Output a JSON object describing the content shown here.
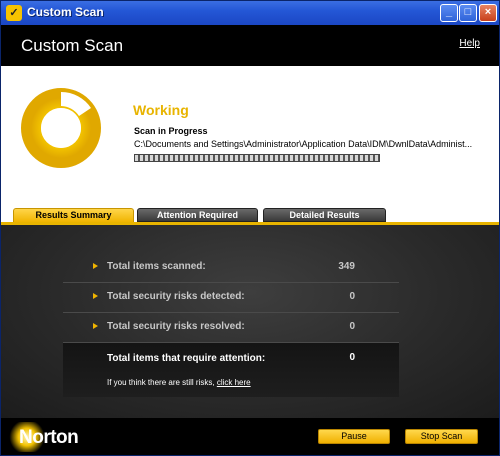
{
  "window": {
    "title": "Custom Scan",
    "controls": {
      "minimize": "_",
      "maximize": "□",
      "close": "×"
    }
  },
  "header": {
    "title": "Custom Scan",
    "help_label": "Help"
  },
  "status": {
    "title": "Working",
    "scan_label": "Scan in Progress",
    "scan_path": "C:\\Documents and Settings\\Administrator\\Application Data\\IDM\\DwnlData\\Administ...",
    "progress": 1.0,
    "accent_color": "#e8b400"
  },
  "tabs": [
    {
      "label": "Results Summary",
      "active": true
    },
    {
      "label": "Attention Required",
      "active": false
    },
    {
      "label": "Detailed Results",
      "active": false
    }
  ],
  "results": {
    "rows": [
      {
        "label": "Total items scanned:",
        "value": "349"
      },
      {
        "label": "Total security risks detected:",
        "value": "0"
      },
      {
        "label": "Total security risks resolved:",
        "value": "0"
      }
    ],
    "total": {
      "label": "Total items that require attention:",
      "value": "0",
      "note": "If you think there are still risks,",
      "link": "click here"
    }
  },
  "footer": {
    "brand": "Norton",
    "pause_label": "Pause",
    "stop_label": "Stop Scan"
  }
}
